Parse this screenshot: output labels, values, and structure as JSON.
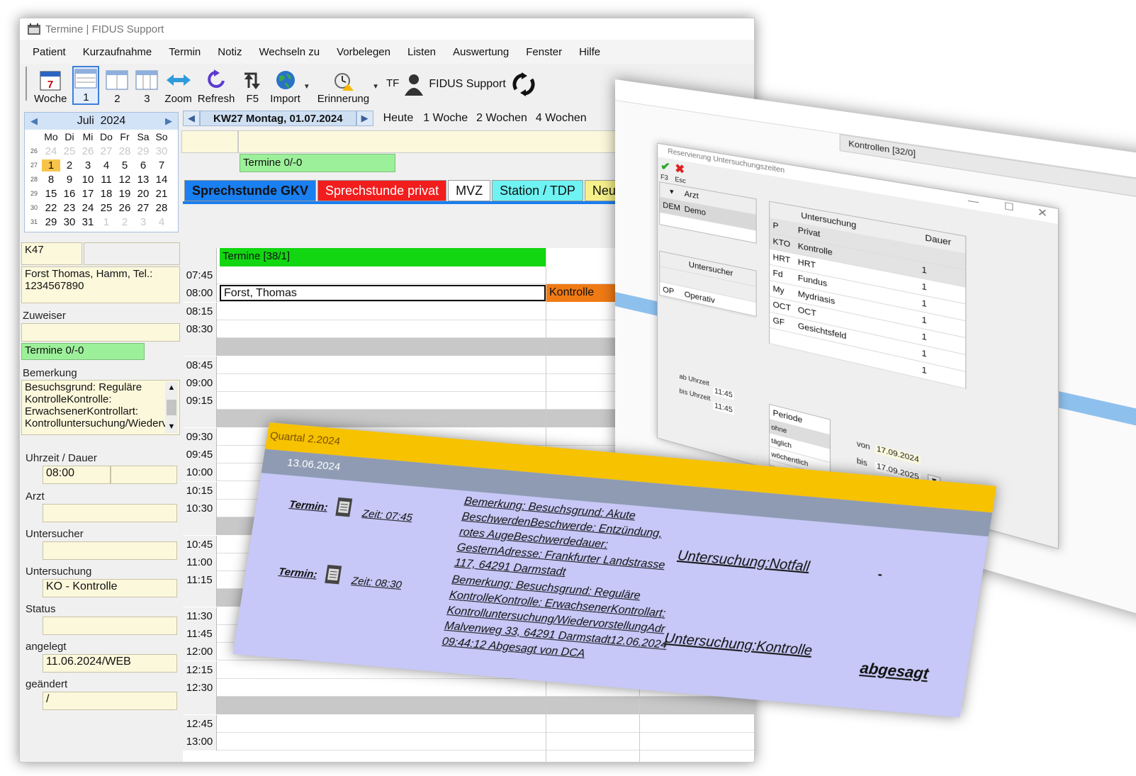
{
  "window": {
    "title": "Termine | FIDUS Support"
  },
  "menu": [
    "Patient",
    "Kurzaufnahme",
    "Termin",
    "Notiz",
    "Wechseln zu",
    "Vorbelegen",
    "Listen",
    "Auswertung",
    "Fenster",
    "Hilfe"
  ],
  "toolbar": {
    "woche": "Woche",
    "v1": "1",
    "v2": "2",
    "v3": "3",
    "zoom": "Zoom",
    "refresh": "Refresh",
    "f5": "F5",
    "import": "Import",
    "erinnerung": "Erinnerung",
    "tf": "TF",
    "user": "FIDUS Support"
  },
  "calendar": {
    "month": "Juli",
    "year": "2024",
    "weekdays": [
      "Mo",
      "Di",
      "Mi",
      "Do",
      "Fr",
      "Sa",
      "So"
    ],
    "weeks": [
      {
        "wk": "26",
        "days": [
          "24",
          "25",
          "26",
          "27",
          "28",
          "29",
          "30"
        ],
        "other": [
          0,
          1,
          2,
          3,
          4,
          5,
          6
        ]
      },
      {
        "wk": "27",
        "days": [
          "1",
          "2",
          "3",
          "4",
          "5",
          "6",
          "7"
        ],
        "other": []
      },
      {
        "wk": "28",
        "days": [
          "8",
          "9",
          "10",
          "11",
          "12",
          "13",
          "14"
        ],
        "other": []
      },
      {
        "wk": "29",
        "days": [
          "15",
          "16",
          "17",
          "18",
          "19",
          "20",
          "21"
        ],
        "other": []
      },
      {
        "wk": "30",
        "days": [
          "22",
          "23",
          "24",
          "25",
          "26",
          "27",
          "28"
        ],
        "other": []
      },
      {
        "wk": "31",
        "days": [
          "29",
          "30",
          "31",
          "1",
          "2",
          "3",
          "4"
        ],
        "other": [
          3,
          4,
          5,
          6
        ]
      }
    ],
    "today": "1"
  },
  "left": {
    "room": "K47",
    "patient": "Forst Thomas, Hamm, Tel.: 1234567890",
    "zuweiser_label": "Zuweiser",
    "termine": "Termine 0/-0",
    "bemerkung_label": "Bemerkung",
    "bemerkung": "Besuchsgrund: Reguläre KontrolleKontrolle: ErwachsenerKontrollart: Kontrolluntersuchung/Wiederv",
    "uhrzeit_label": "Uhrzeit / Dauer",
    "uhrzeit": "08:00",
    "arzt_label": "Arzt",
    "untersucher_label": "Untersucher",
    "untersuchung_label": "Untersuchung",
    "untersuchung": "KO - Kontrolle",
    "status_label": "Status",
    "angelegt_label": "angelegt",
    "angelegt": "11.06.2024/WEB",
    "geaendert_label": "geändert",
    "geaendert": "/"
  },
  "nav": {
    "kw": "KW27  Montag, 01.07.2024",
    "heute": "Heute",
    "w1": "1 Woche",
    "w2": "2 Wochen",
    "w4": "4 Wochen"
  },
  "top_termine": "Termine 0/-0",
  "tabs": [
    {
      "label": "Sprechstunde GKV",
      "bg": "#1a7ff0",
      "fg": "#111"
    },
    {
      "label": "Sprechstunde privat",
      "bg": "#f21d1d",
      "fg": "#fff"
    },
    {
      "label": "MVZ",
      "bg": "#ffffff",
      "fg": "#111"
    },
    {
      "label": "Station / TDP",
      "bg": "#6ef2f2",
      "fg": "#111"
    },
    {
      "label": "Neu",
      "bg": "#f5f08a",
      "fg": "#111"
    }
  ],
  "schedule": {
    "header": "Termine [38/1]",
    "times": [
      "07:45",
      "08:00",
      "08:15",
      "08:30",
      "",
      "08:45",
      "09:00",
      "09:15",
      "",
      "09:30",
      "09:45",
      "10:00",
      "10:15",
      "10:30",
      "",
      "10:45",
      "11:00",
      "11:15",
      "",
      "11:30",
      "11:45",
      "12:00",
      "12:15",
      "12:30",
      "",
      "12:45",
      "13:00"
    ],
    "appt_name": "Forst, Thomas",
    "appt_type": "Kontrolle"
  },
  "dialog": {
    "title": "Reservierung Untersuchungszeiten",
    "f3": "F3",
    "esc": "Esc",
    "kontrollen": "Kontrollen [32/0]",
    "arzt_hdr": "Arzt",
    "arzt": [
      [
        "DEM",
        "Demo"
      ]
    ],
    "untersucher_hdr": "Untersucher",
    "untersucher": [
      [
        "OP",
        "Operativ"
      ]
    ],
    "untersuchung_hdr": "Untersuchung",
    "dauer_hdr": "Dauer",
    "rows": [
      [
        "P",
        "Privat",
        ""
      ],
      [
        "KTO",
        "Kontrolle",
        "1"
      ],
      [
        "HRT",
        "HRT",
        "1"
      ],
      [
        "Fd",
        "Fundus",
        "1"
      ],
      [
        "My",
        "Mydriasis",
        "1"
      ],
      [
        "OCT",
        "OCT",
        "1"
      ],
      [
        "GF",
        "Gesichtsfeld",
        "1"
      ],
      [
        "",
        "",
        "1"
      ]
    ],
    "ab_label": "ab Uhrzeit",
    "ab": "11:45",
    "bis_label": "bis Uhrzeit",
    "bis": "11:45",
    "periode": "Periode",
    "periods": [
      "ohne",
      "täglich",
      "wöchentlich"
    ],
    "von_label": "von",
    "von": "17.09.2024",
    "bis2_label": "bis",
    "bis2": "17.09.2025"
  },
  "card": {
    "quartal": "Quartal 2.2024",
    "date": "13.06.2024",
    "e1": {
      "termin": "Termin:",
      "zeit": "Zeit: 07:45",
      "bem": [
        "Bemerkung: Besuchsgrund: Akute",
        "BeschwerdenBeschwerde: Entzündung,",
        "rotes AugeBeschwerdedauer:",
        "GesternAdresse: Frankfurter Landstrasse",
        "117, 64291 Darmstadt"
      ],
      "unt": "Untersuchung:Notfall",
      "status": "-"
    },
    "e2": {
      "termin": "Termin:",
      "zeit": "Zeit: 08:30",
      "bem": [
        "Bemerkung: Besuchsgrund: Reguläre",
        "KontrolleKontrolle: ErwachsenerKontrollart:",
        "Kontrolluntersuchung/WiedervorstellungAdr",
        "Malvenweg 33, 64291 Darmstadt12.06.2024",
        "09:44:12 Abgesagt von DCA"
      ],
      "unt": "Untersuchung:Kontrolle",
      "status": "abgesagt"
    }
  }
}
